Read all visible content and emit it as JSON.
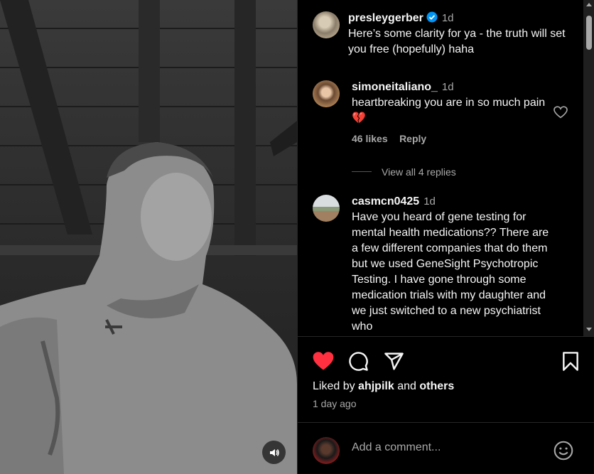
{
  "post": {
    "author": "presleygerber",
    "author_time": "1d",
    "caption": "Here’s some clarity for ya - the truth will set you free (hopefully) haha"
  },
  "comments": [
    {
      "user": "simoneitaliano_",
      "time": "1d",
      "text": "heartbreaking you are in so much pain 💔",
      "likes": "46 likes",
      "reply_label": "Reply",
      "view_replies": "View all 4 replies"
    },
    {
      "user": "casmcn0425",
      "time": "1d",
      "text": "Have you heard of gene testing for mental health medications?? There are a few different companies that do them but we used GeneSight Psychotropic Testing. I have gone through some medication trials with my daughter and we just switched to a new psychiatrist who"
    }
  ],
  "likes_summary": {
    "prefix": "Liked by",
    "user": "ahjpilk",
    "joiner": "and",
    "others": "others"
  },
  "posted_ago": "1 day ago",
  "comment_box": {
    "placeholder": "Add a comment..."
  },
  "icons": {
    "like": "heart-filled-icon",
    "comment": "speech-bubble-icon",
    "share": "paper-plane-icon",
    "save": "bookmark-icon",
    "emoji": "smiley-icon",
    "sound": "speaker-icon"
  },
  "colors": {
    "like_red": "#ff3040",
    "verified_blue": "#0095f6",
    "muted": "#a8a8a8"
  }
}
